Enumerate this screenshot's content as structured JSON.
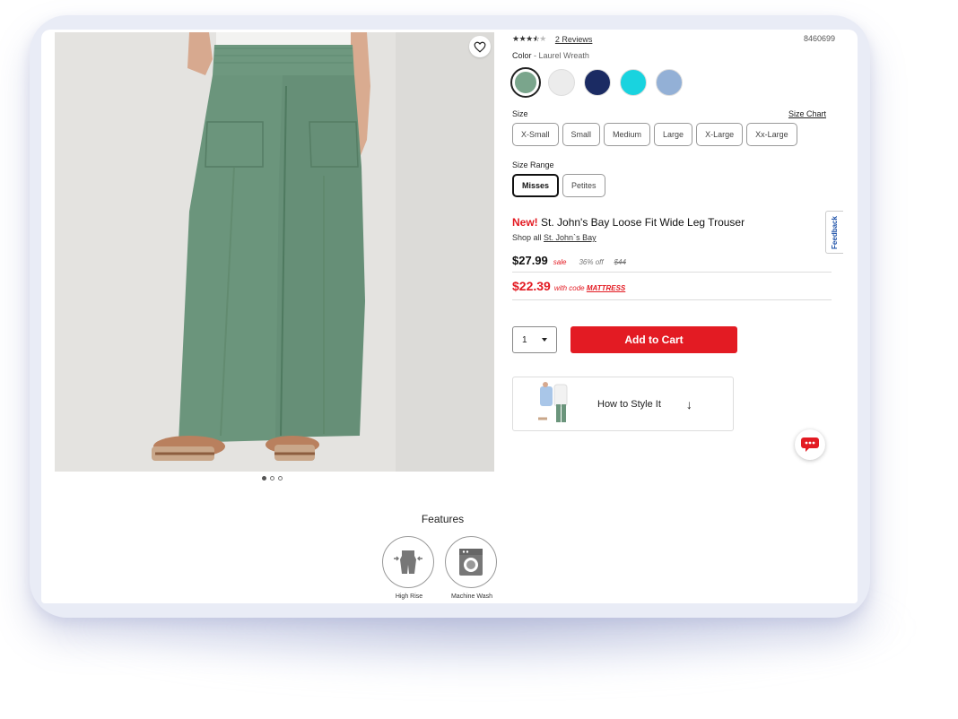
{
  "product": {
    "rating": 3.5,
    "reviews_label": "2 Reviews",
    "sku": "8460699",
    "color_label": "Color",
    "color_value": "Laurel Wreath",
    "swatches": [
      {
        "name": "Laurel Wreath",
        "hex": "#7aa58c"
      },
      {
        "name": "white",
        "hex": "#ececec"
      },
      {
        "name": "navy",
        "hex": "#1b2b63"
      },
      {
        "name": "turquoise",
        "hex": "#19d3df"
      },
      {
        "name": "chambray",
        "hex": "#93b0d6"
      }
    ],
    "size_label": "Size",
    "size_chart_label": "Size Chart",
    "sizes": [
      "X-Small",
      "Small",
      "Medium",
      "Large",
      "X-Large",
      "Xx-Large"
    ],
    "size_range_label": "Size Range",
    "size_ranges": [
      "Misses",
      "Petites"
    ],
    "selected_size_range": "Misses",
    "new_label": "New!",
    "title": "St. John's Bay Loose Fit Wide Leg Trouser",
    "shop_all_prefix": "Shop all",
    "brand": "St. John`s Bay",
    "sale_price": "$27.99",
    "sale_label": "sale",
    "percent_off": "36% off",
    "original_price": "$44",
    "promo_price": "$22.39",
    "promo_text": "with code",
    "promo_code": "MATTRESS",
    "quantity": "1",
    "add_to_cart_label": "Add to Cart",
    "style_it_label": "How to Style It"
  },
  "feedback_label": "Feedback",
  "features": {
    "title": "Features",
    "items": [
      {
        "label": "High Rise",
        "icon": "high-rise-icon"
      },
      {
        "label": "Machine Wash",
        "icon": "washing-machine-icon"
      }
    ]
  },
  "colors": {
    "accent_red": "#e31b23",
    "pants_green": "#6b957c"
  }
}
